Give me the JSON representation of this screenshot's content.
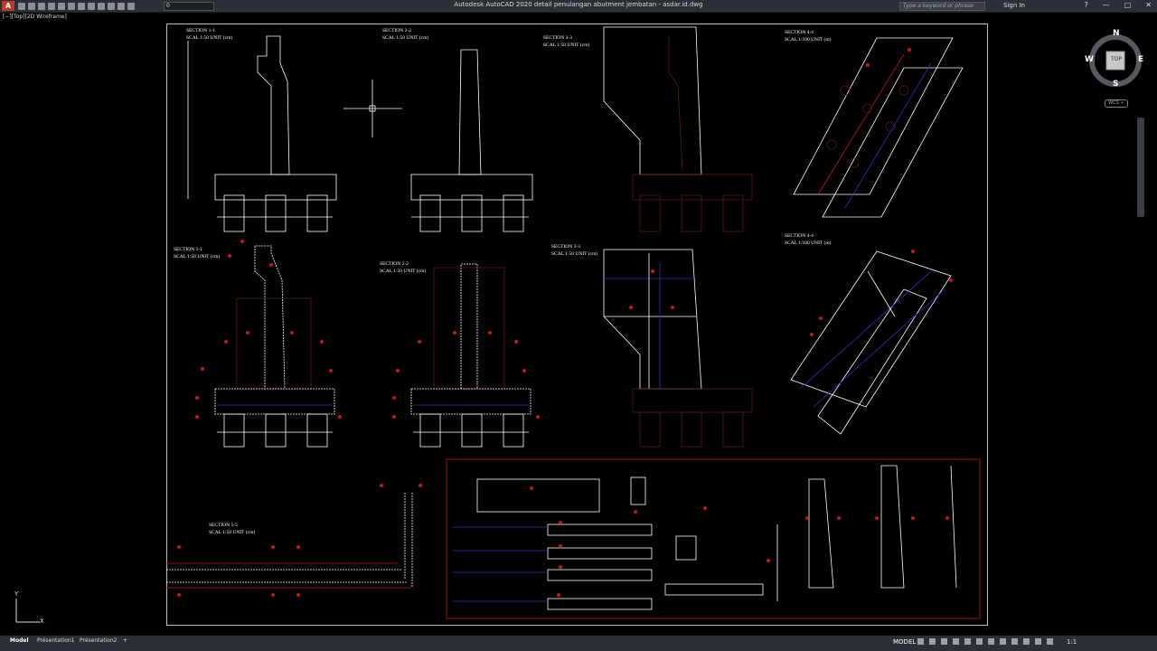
{
  "app": {
    "title": "Autodesk AutoCAD 2020    detail penulangan abutment jembatan - asdar.id.dwg",
    "logo": "A",
    "layer_value": "0",
    "search_placeholder": "Type a keyword or phrase",
    "sign_in": "Sign In",
    "help": "?"
  },
  "viewport": {
    "label": "[−][Top][2D Wireframe]"
  },
  "viewcube": {
    "north": "N",
    "south": "S",
    "east": "E",
    "west": "W",
    "top": "TOP",
    "wcs": "WCS ÷"
  },
  "ucs": {
    "x": "X",
    "y": "Y"
  },
  "drawing": {
    "section_labels": [
      {
        "title": "SECTION 1-1",
        "scale": "SCAL 1:50  UNIT (cm)"
      },
      {
        "title": "SECTION 2-2",
        "scale": "SCAL 1:50  UNIT (cm)"
      },
      {
        "title": "SECTION 3-3",
        "scale": "SCAL 1:50  UNIT (cm)"
      },
      {
        "title": "SECTION 4-4",
        "scale": "SCAL 1/100  UNIT (m)"
      },
      {
        "title": "SECTION 1-1",
        "scale": "SCAL 1:50  UNIT (cm)"
      },
      {
        "title": "SECTION 2-2",
        "scale": "SCAL 1:50  UNIT (cm)"
      },
      {
        "title": "SECTION 3-3",
        "scale": "SCAL 1:50  UNIT (cm)"
      },
      {
        "title": "SECTION 4-4",
        "scale": "SCAL 1/100  UNIT (m)"
      },
      {
        "title": "SECTION 5-5",
        "scale": "SCAL 1:50  UNIT (cm)"
      }
    ],
    "colors": {
      "background": "#000000",
      "frame": "#bfbfbf",
      "rebar_red": "#c01818",
      "stirrup_blue": "#3030b8",
      "pile_brown": "#5a1a14"
    }
  },
  "status": {
    "tabs": [
      "Model",
      "Présentation1",
      "Présentation2",
      "+"
    ],
    "mode": "MODEL",
    "scale": "1:1"
  }
}
